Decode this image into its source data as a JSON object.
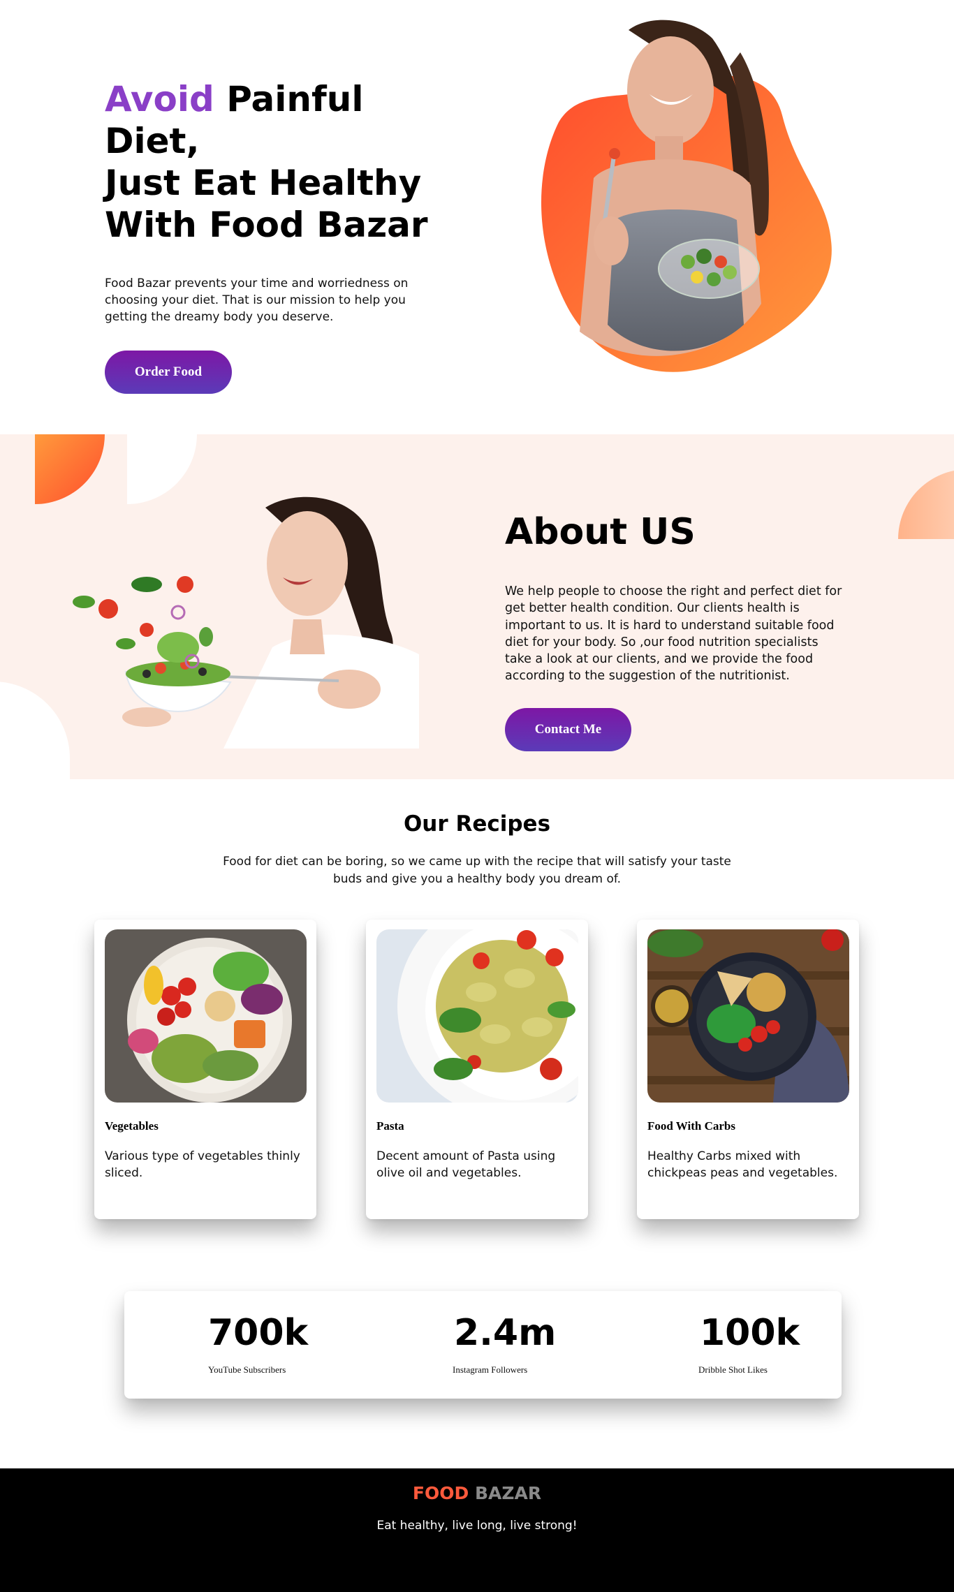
{
  "hero": {
    "title_accent": "Avoid",
    "title_rest": " Painful Diet,",
    "title_line2": "Just Eat Healthy",
    "title_line3": "With Food Bazar",
    "description": "Food Bazar prevents your time and worriedness on choosing your diet. That is our mission to help you getting the dreamy body you deserve.",
    "button_label": "Order Food"
  },
  "about": {
    "title": "About US",
    "description": "We help people to choose the right and perfect diet for get better health condition. Our clients health is important to us. It is hard to understand suitable food diet for your body. So ,our food nutrition specialists take a look at our clients, and we provide the food according to the suggestion of the nutritionist.",
    "button_label": "Contact Me"
  },
  "recipes": {
    "title": "Our Recipes",
    "subtitle": "Food for diet can be boring, so we came up with the recipe that will satisfy your taste buds and give you a healthy body you dream of.",
    "cards": [
      {
        "title": "Vegetables",
        "text": "Various type of vegetables thinly sliced."
      },
      {
        "title": "Pasta",
        "text": "Decent amount of Pasta using olive oil and vegetables."
      },
      {
        "title": "Food With Carbs",
        "text": "Healthy Carbs mixed with chickpeas peas and vegetables."
      }
    ]
  },
  "stats": [
    {
      "value": "700k",
      "label": "YouTube Subscribers"
    },
    {
      "value": "2.4m",
      "label": "Instagram Followers"
    },
    {
      "value": "100k",
      "label": "Dribble Shot Likes"
    }
  ],
  "footer": {
    "brand_1": "FOOD",
    "brand_2": "BAZAR",
    "tagline": "Eat healthy, live long, live strong!"
  },
  "colors": {
    "accent_purple": "#8a3fc7",
    "button_gradient_start": "#7d17a5",
    "button_gradient_end": "#5b3bb8",
    "about_background": "#fdf1ec",
    "brand_orange": "#ff5a3c",
    "brand_grey": "#8a8a8a"
  }
}
